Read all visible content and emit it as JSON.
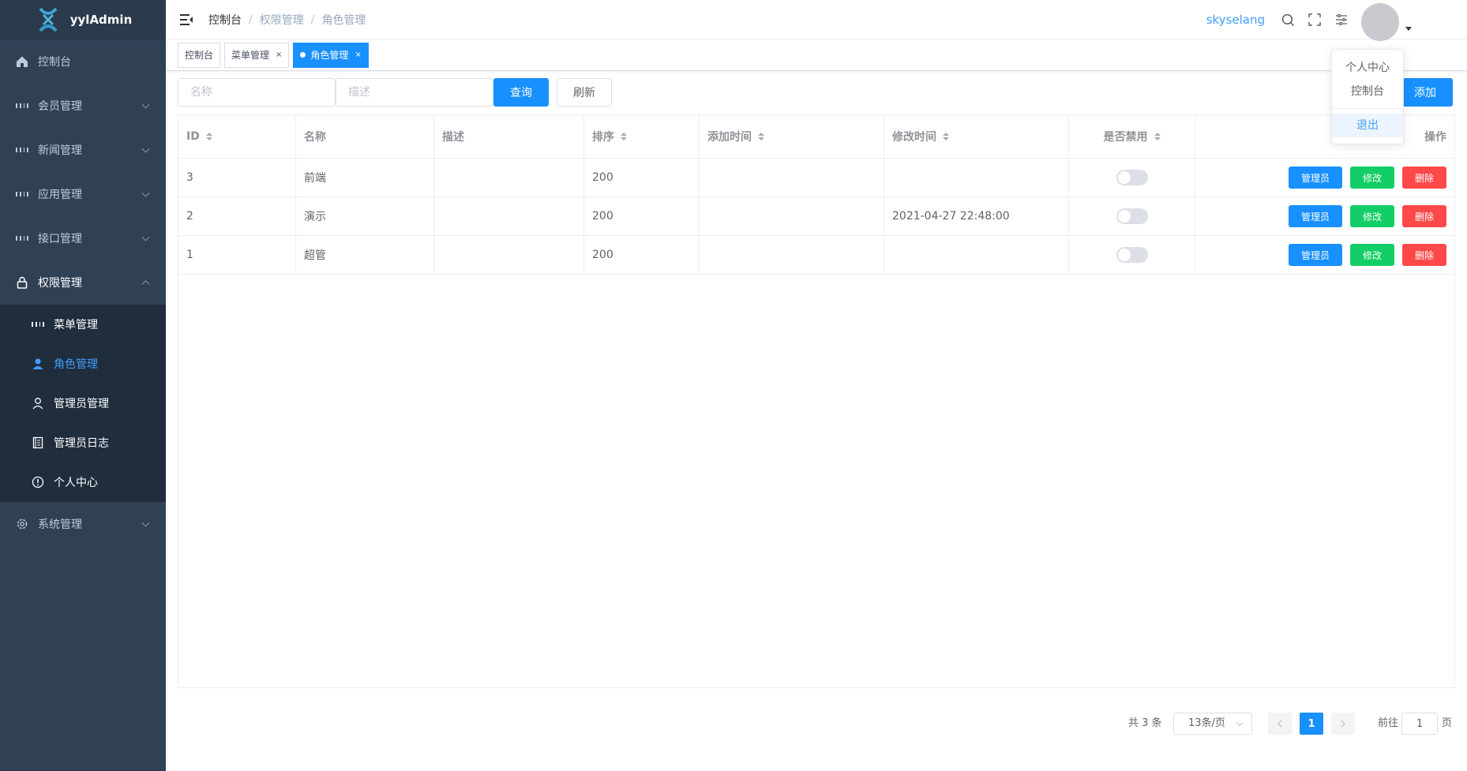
{
  "app": {
    "logo_text": "yylAdmin"
  },
  "sidebar": {
    "items": [
      {
        "label": "控制台"
      },
      {
        "label": "会员管理"
      },
      {
        "label": "新闻管理"
      },
      {
        "label": "应用管理"
      },
      {
        "label": "接口管理"
      },
      {
        "label": "权限管理"
      },
      {
        "label": "系统管理"
      }
    ],
    "subitems": [
      {
        "label": "菜单管理"
      },
      {
        "label": "角色管理"
      },
      {
        "label": "管理员管理"
      },
      {
        "label": "管理员日志"
      },
      {
        "label": "个人中心"
      }
    ]
  },
  "breadcrumb": [
    "控制台",
    "权限管理",
    "角色管理"
  ],
  "header": {
    "username": "skyselang"
  },
  "tags": [
    {
      "label": "控制台"
    },
    {
      "label": "菜单管理",
      "close": "×"
    },
    {
      "label": "角色管理",
      "close": "×"
    }
  ],
  "search": {
    "name_placeholder": "名称",
    "desc_placeholder": "描述",
    "query_label": "查询",
    "refresh_label": "刷新",
    "add_label": "添加"
  },
  "table": {
    "headers": [
      "ID",
      "名称",
      "描述",
      "排序",
      "添加时间",
      "修改时间",
      "是否禁用",
      "操作"
    ],
    "rows": [
      {
        "id": "3",
        "name": "前端",
        "desc": "",
        "sort": "200",
        "add_time": "",
        "update_time": "",
        "disabled": false
      },
      {
        "id": "2",
        "name": "演示",
        "desc": "",
        "sort": "200",
        "add_time": "",
        "update_time": "2021-04-27 22:48:00",
        "disabled": false
      },
      {
        "id": "1",
        "name": "超管",
        "desc": "",
        "sort": "200",
        "add_time": "",
        "update_time": "",
        "disabled": false
      }
    ],
    "actions": {
      "admin": "管理员",
      "edit": "修改",
      "delete": "删除"
    }
  },
  "dropdown": {
    "items": [
      "个人中心",
      "控制台"
    ],
    "logout": "退出"
  },
  "pagination": {
    "total": "共 3 条",
    "page_size": "13条/页",
    "current_page": "1",
    "goto_prefix": "前往",
    "goto_value": "1",
    "goto_suffix": "页"
  },
  "colors": {
    "primary": "#1890ff",
    "success": "#13ce66",
    "danger": "#ff4949",
    "sidebar_bg": "#304156"
  }
}
